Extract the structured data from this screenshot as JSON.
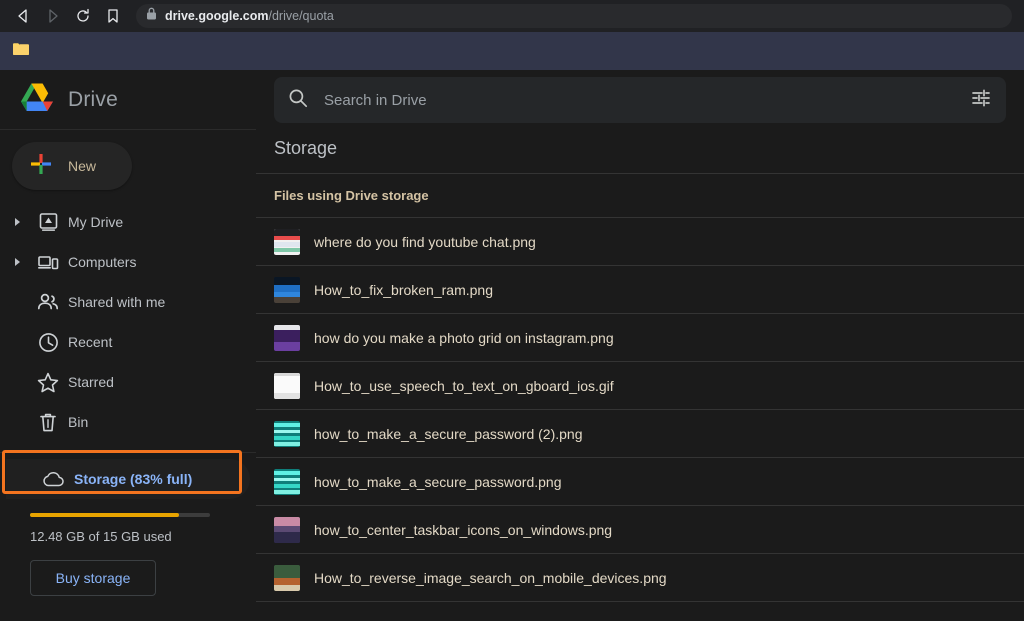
{
  "browser": {
    "back_icon": "back-arrow-icon",
    "forward_icon": "forward-arrow-icon",
    "reload_icon": "reload-icon",
    "bookmark_icon": "bookmark-icon",
    "lock_icon": "lock-icon",
    "url_domain": "drive.google.com",
    "url_path": "/drive/quota",
    "bookmarks": [
      {
        "name": "bookmark-folder",
        "icon": "folder-icon",
        "label": ""
      }
    ]
  },
  "sidebar": {
    "logo": "google-drive-logo",
    "wordmark": "Drive",
    "new_button": {
      "label": "New",
      "icon": "plus-icon"
    },
    "items": [
      {
        "label": "My Drive",
        "icon": "my-drive-icon",
        "caret": true
      },
      {
        "label": "Computers",
        "icon": "computers-icon",
        "caret": true
      },
      {
        "label": "Shared with me",
        "icon": "shared-with-me-icon",
        "caret": false
      },
      {
        "label": "Recent",
        "icon": "clock-icon",
        "caret": false
      },
      {
        "label": "Starred",
        "icon": "star-icon",
        "caret": false
      },
      {
        "label": "Bin",
        "icon": "trash-icon",
        "caret": false
      }
    ],
    "storage": {
      "label": "Storage (83% full)",
      "icon": "cloud-icon",
      "percent_full": 83,
      "used_text": "12.48 GB of 15 GB used",
      "buy_label": "Buy storage",
      "highlight_color": "#f4741f",
      "bar_color": "#e8a400",
      "active_color": "#8ab4f8"
    }
  },
  "search": {
    "placeholder": "Search in Drive",
    "value": "",
    "search_icon": "search-icon",
    "filter_icon": "tune-filter-icon"
  },
  "main": {
    "page_title": "Storage",
    "column_header": "Files using Drive storage",
    "files": [
      {
        "name": "where do you find youtube chat.png",
        "thumb": "screenshot-light-thumbnail"
      },
      {
        "name": "How_to_fix_broken_ram.png",
        "thumb": "blue-screenshot-thumbnail"
      },
      {
        "name": "how do you make a photo grid on instagram.png",
        "thumb": "purple-screenshot-thumbnail"
      },
      {
        "name": "How_to_use_speech_to_text_on_gboard_ios.gif",
        "thumb": "white-document-thumbnail"
      },
      {
        "name": "how_to_make_a_secure_password (2).png",
        "thumb": "teal-screenshot-thumbnail"
      },
      {
        "name": "how_to_make_a_secure_password.png",
        "thumb": "teal-screenshot-thumbnail"
      },
      {
        "name": "how_to_center_taskbar_icons_on_windows.png",
        "thumb": "sunset-screenshot-thumbnail"
      },
      {
        "name": "How_to_reverse_image_search_on_mobile_devices.png",
        "thumb": "green-screenshot-thumbnail"
      }
    ]
  }
}
